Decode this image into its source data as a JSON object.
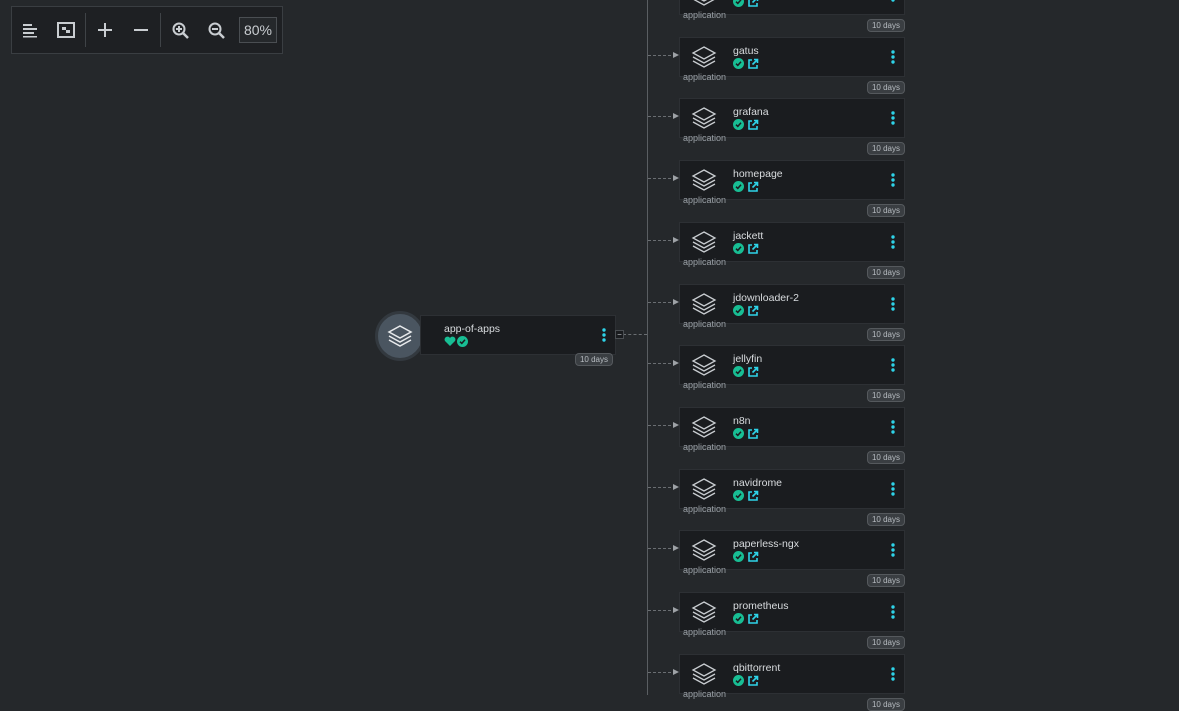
{
  "toolbar": {
    "zoom_level": "80%",
    "buttons": [
      "align-left-icon",
      "fit-screen-icon",
      "plus-icon",
      "minus-icon",
      "zoom-in-icon",
      "zoom-out-icon"
    ]
  },
  "colors": {
    "background": "#25282b",
    "node": "#1a1c1f",
    "accent": "#18be94",
    "link": "#00d0e6"
  },
  "root": {
    "name": "app-of-apps",
    "age": "10 days"
  },
  "apps": [
    {
      "name": "",
      "kind": "application",
      "age": "10 days"
    },
    {
      "name": "gatus",
      "kind": "application",
      "age": "10 days"
    },
    {
      "name": "grafana",
      "kind": "application",
      "age": "10 days"
    },
    {
      "name": "homepage",
      "kind": "application",
      "age": "10 days"
    },
    {
      "name": "jackett",
      "kind": "application",
      "age": "10 days"
    },
    {
      "name": "jdownloader-2",
      "kind": "application",
      "age": "10 days"
    },
    {
      "name": "jellyfin",
      "kind": "application",
      "age": "10 days"
    },
    {
      "name": "n8n",
      "kind": "application",
      "age": "10 days"
    },
    {
      "name": "navidrome",
      "kind": "application",
      "age": "10 days"
    },
    {
      "name": "paperless-ngx",
      "kind": "application",
      "age": "10 days"
    },
    {
      "name": "prometheus",
      "kind": "application",
      "age": "10 days"
    },
    {
      "name": "qbittorrent",
      "kind": "application",
      "age": "10 days"
    }
  ]
}
